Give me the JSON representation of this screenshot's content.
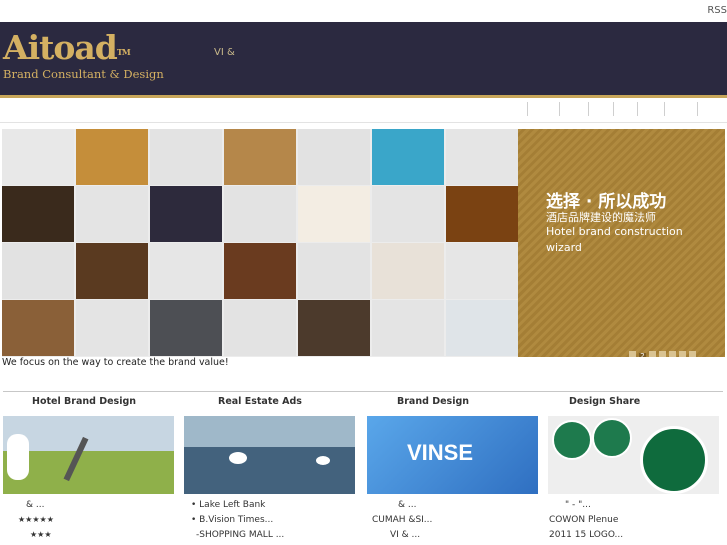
{
  "topbar": {
    "rss": "RSS"
  },
  "header": {
    "logo_name": "Aitoad",
    "logo_tm": "TM",
    "logo_tag": "Brand Consultant & Design",
    "text": "VI  &"
  },
  "banner": {
    "tiles": [
      {
        "color": "#e8e8e8"
      },
      {
        "color": "#c58e3a"
      },
      {
        "color": "#e3e3e3"
      },
      {
        "color": "#b5874a"
      },
      {
        "color": "#e2e2e2"
      },
      {
        "color": "#3aa6c9"
      },
      {
        "color": "#e5e5e5"
      },
      {
        "color": "#3a2a1c"
      },
      {
        "color": "#e4e4e4"
      },
      {
        "color": "#2d2a3c"
      },
      {
        "color": "#e3e3e3"
      },
      {
        "color": "#f3ede3"
      },
      {
        "color": "#e4e4e4"
      },
      {
        "color": "#7a4212"
      },
      {
        "color": "#e2e2e2"
      },
      {
        "color": "#5a3a20"
      },
      {
        "color": "#e6e6e6"
      },
      {
        "color": "#6a3b1f"
      },
      {
        "color": "#e3e3e3"
      },
      {
        "color": "#e8e1d8"
      },
      {
        "color": "#e6e6e6"
      },
      {
        "color": "#8a6038"
      },
      {
        "color": "#e4e4e4"
      },
      {
        "color": "#4d4f54"
      },
      {
        "color": "#e3e3e3"
      },
      {
        "color": "#4c3a2c"
      },
      {
        "color": "#e4e4e4"
      },
      {
        "color": "#dfe4e8"
      }
    ],
    "title": "选择 · 所以成功",
    "subtitle": "酒店品牌建设的魔法师",
    "english_1": "Hotel brand construction",
    "english_2": "wizard",
    "dots": [
      "",
      "2",
      "",
      "",
      "",
      "",
      ""
    ]
  },
  "slogan": "We focus on the way to create the brand value!",
  "columns": [
    {
      "title": "Hotel Brand Design",
      "thumb_color": "#7fae3a",
      "lines": [
        "&    ...",
        "★★★★★",
        "★★★"
      ]
    },
    {
      "title": "Real Estate Ads",
      "thumb_color": "#5a7fa0",
      "lines": [
        "•    Lake Left Bank",
        "•    B.Vision Times...",
        "-SHOPPING MALL   ..."
      ]
    },
    {
      "title": "Brand Design",
      "thumb_color": "#4a8fd8",
      "thumb_text": "VINSE",
      "lines": [
        "&  ...",
        "CUMAH        &SI...",
        "VI  &  ..."
      ]
    },
    {
      "title": "Design Share",
      "thumb_color": "#ececec",
      "lines": [
        "\" - \"...",
        "COWON    Plenue",
        "2011  15      LOGO..."
      ]
    }
  ],
  "colors": {
    "header_bg": "#2b2940",
    "gold": "#d4b062",
    "banner_gold": "#b08a3f"
  }
}
